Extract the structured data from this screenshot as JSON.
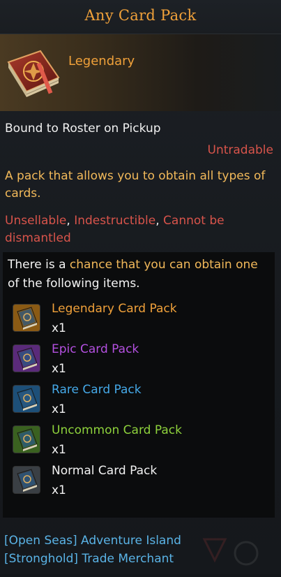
{
  "title": "Any Card Pack",
  "grade": "Legendary",
  "bound": "Bound to Roster on Pickup",
  "trade": "Untradable",
  "description": "A pack that allows you to obtain all types of cards.",
  "restrictions": {
    "unsellable": "Unsellable",
    "sep1": ", ",
    "indestructible": "Indestructible",
    "sep2": ", ",
    "dismantle": "Cannot be dismantled"
  },
  "contents": {
    "prefix": "There is a ",
    "highlight": "chance that you can obtain one",
    "suffix": " of the following items.",
    "items": [
      {
        "name": "Legendary Card Pack",
        "qty": "x1",
        "color": "#f0a13a",
        "bg": "#8a5a14"
      },
      {
        "name": "Epic Card Pack",
        "qty": "x1",
        "color": "#b450e0",
        "bg": "#5a2a7a"
      },
      {
        "name": "Rare Card Pack",
        "qty": "x1",
        "color": "#45a9e8",
        "bg": "#1d4f78"
      },
      {
        "name": "Uncommon Card Pack",
        "qty": "x1",
        "color": "#8ed23c",
        "bg": "#3a6120"
      },
      {
        "name": "Normal Card Pack",
        "qty": "x1",
        "color": "#f2f2f2",
        "bg": "#3a3f44"
      }
    ]
  },
  "sources": [
    "[Open Seas] Adventure Island",
    "[Stronghold] Trade Merchant"
  ],
  "icon": "red-tome-icon"
}
